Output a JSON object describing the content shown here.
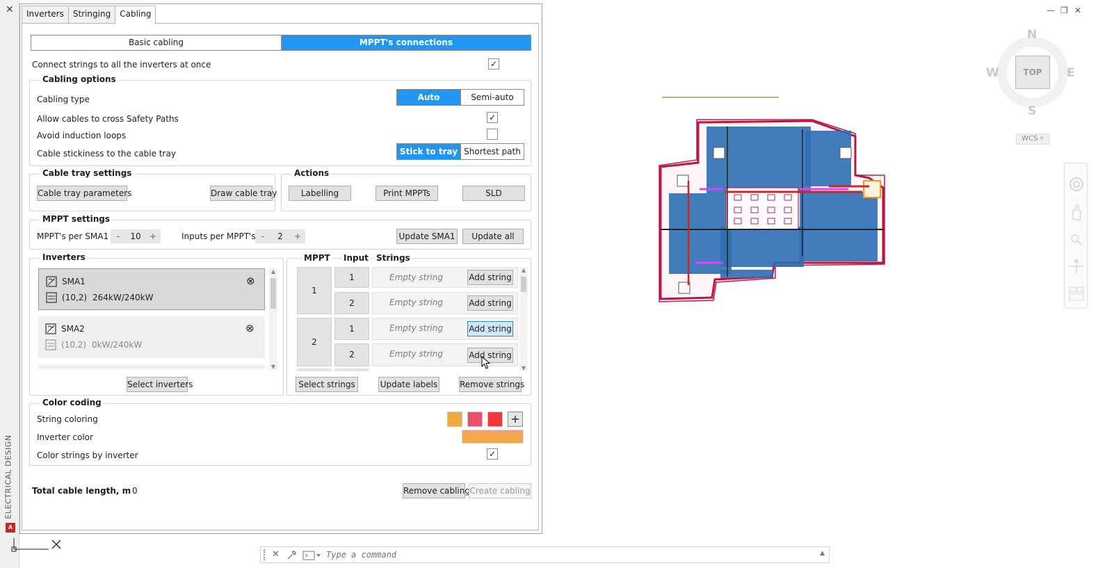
{
  "sidebar": {
    "title": "ELECTRICAL DESIGN",
    "close_glyph": "✕",
    "app_badge": "A"
  },
  "tabs": [
    {
      "label": "Inverters",
      "active": false
    },
    {
      "label": "Stringing",
      "active": false
    },
    {
      "label": "Cabling",
      "active": true
    }
  ],
  "mode_switch": {
    "basic_label": "Basic cabling",
    "mppt_label": "MPPT's connections",
    "selected": "MPPT's connections"
  },
  "connect_all": {
    "label": "Connect strings to all the inverters at once",
    "checked": true
  },
  "cabling_options": {
    "title": "Cabling options",
    "type_label": "Cabling type",
    "type_auto": "Auto",
    "type_semi": "Semi-auto",
    "type_selected": "Auto",
    "allow_cross_label": "Allow cables to cross Safety Paths",
    "allow_cross_checked": true,
    "avoid_loops_label": "Avoid induction loops",
    "avoid_loops_checked": false,
    "stickiness_label": "Cable stickiness to the cable tray",
    "stick_tray": "Stick to tray",
    "shortest_path": "Shortest path",
    "stickiness_selected": "Stick to tray"
  },
  "tray_settings": {
    "title": "Cable tray settings",
    "params_button": "Cable tray parameters",
    "draw_button": "Draw cable tray"
  },
  "actions": {
    "title": "Actions",
    "labelling": "Labelling",
    "print_mppts": "Print MPPTs",
    "sld": "SLD"
  },
  "mppt_settings": {
    "title": "MPPT settings",
    "per_sma_label": "MPPT's per SMA1",
    "per_sma_value": "10",
    "inputs_label": "Inputs per MPPT's",
    "inputs_value": "2",
    "minus": "-",
    "plus": "+",
    "update_sma_button": "Update SMA1",
    "update_all_button": "Update all"
  },
  "inverters": {
    "title": "Inverters",
    "items": [
      {
        "name": "SMA1",
        "config": "(10,2)",
        "power": "264kW/240kW",
        "selected": true
      },
      {
        "name": "SMA2",
        "config": "(10,2)",
        "power": "0kW/240kW",
        "selected": false
      }
    ],
    "select_button": "Select inverters",
    "remove_glyph": "⊗"
  },
  "mppt_table": {
    "headers": {
      "mppt": "MPPT",
      "input": "Input",
      "strings": "Strings"
    },
    "rows": [
      {
        "mppt": "1",
        "inputs": [
          {
            "input": "1",
            "string": "Empty string",
            "button": "Add string"
          },
          {
            "input": "2",
            "string": "Empty string",
            "button": "Add string"
          }
        ]
      },
      {
        "mppt": "2",
        "inputs": [
          {
            "input": "1",
            "string": "Empty string",
            "button": "Add string"
          },
          {
            "input": "2",
            "string": "Empty string",
            "button": "Add string"
          }
        ]
      }
    ],
    "select_strings": "Select strings",
    "update_labels": "Update labels",
    "remove_strings": "Remove strings"
  },
  "color_coding": {
    "title": "Color coding",
    "string_coloring_label": "String coloring",
    "string_colors": [
      "#f0a840",
      "#e8506a",
      "#f03838"
    ],
    "add_glyph": "+",
    "inverter_color_label": "Inverter color",
    "inverter_color": "#f6a650",
    "by_inverter_label": "Color strings by inverter",
    "by_inverter_checked": true
  },
  "footer": {
    "total_label": "Total cable length, m",
    "total_value": "0",
    "remove_button": "Remove cabling",
    "create_button": "Create cabling"
  },
  "viewport": {
    "controls": [
      "—",
      "❐",
      "✕"
    ],
    "compass": {
      "n": "N",
      "s": "S",
      "e": "E",
      "w": "W",
      "center": "TOP"
    },
    "wcs_label": "WCS ▿"
  },
  "command_line": {
    "placeholder": "Type a command"
  },
  "colors": {
    "accent": "#2196f3",
    "outline": "#b8173e",
    "panels": "#2f6fb3"
  }
}
